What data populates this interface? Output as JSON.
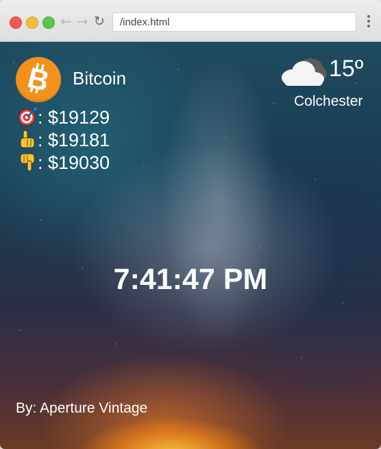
{
  "browser": {
    "url": "/index.html"
  },
  "coin": {
    "name": "Bitcoin",
    "logo_icon": "bitcoin-logo-icon",
    "accent": "#f2911c"
  },
  "prices": [
    {
      "icon": "target-icon",
      "label": ": $19129"
    },
    {
      "icon": "pointing-up-icon",
      "label": ": $19181"
    },
    {
      "icon": "pointing-down-icon",
      "label": ": $19030"
    }
  ],
  "weather": {
    "icon": "cloud-icon",
    "temperature": "15º",
    "city": "Colchester"
  },
  "clock": {
    "time": "7:41:47 PM"
  },
  "credit": {
    "text": "By: Aperture Vintage"
  }
}
